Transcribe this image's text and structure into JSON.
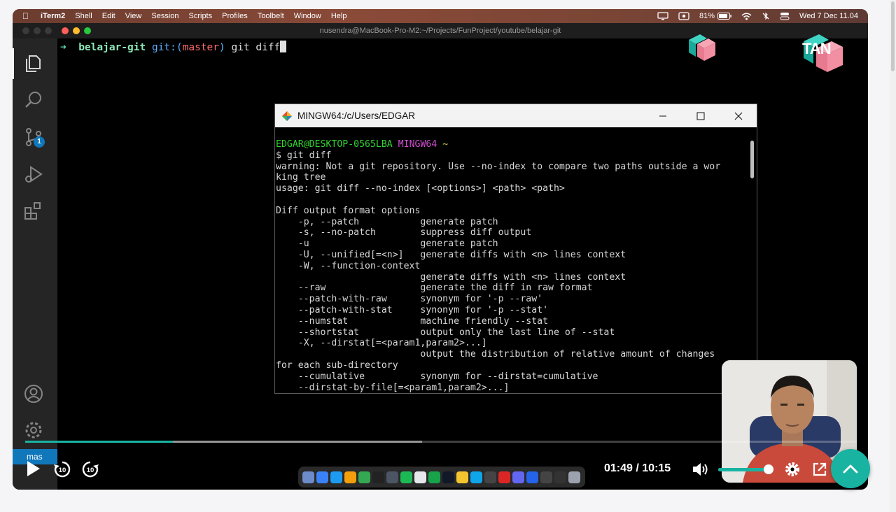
{
  "menubar": {
    "app": "iTerm2",
    "items": [
      "Shell",
      "Edit",
      "View",
      "Session",
      "Scripts",
      "Profiles",
      "Toolbelt",
      "Window",
      "Help"
    ],
    "battery": "81%",
    "clock": "Wed 7 Dec  11.04"
  },
  "iterm": {
    "title": "nusendra@MacBook-Pro-M2:~/Projects/FunProject/youtube/belajar-git",
    "prompt_dir": "belajar-git",
    "prompt_git": "git:(",
    "prompt_branch": "master",
    "prompt_git_close": ")",
    "command": " git diff"
  },
  "activity": {
    "scm_badge": "1",
    "branch": "mas"
  },
  "logo_text": "TAN",
  "mingw": {
    "title": "MINGW64:/c/Users/EDGAR",
    "prompt_user": "EDGAR@DESKTOP-0565LBA",
    "prompt_env": "MINGW64",
    "prompt_path": "~",
    "lines": [
      "$ git diff",
      "warning: Not a git repository. Use --no-index to compare two paths outside a wor",
      "king tree",
      "usage: git diff --no-index [<options>] <path> <path>",
      "",
      "Diff output format options",
      "    -p, --patch           generate patch",
      "    -s, --no-patch        suppress diff output",
      "    -u                    generate patch",
      "    -U, --unified[=<n>]   generate diffs with <n> lines context",
      "    -W, --function-context",
      "                          generate diffs with <n> lines context",
      "    --raw                 generate the diff in raw format",
      "    --patch-with-raw      synonym for '-p --raw'",
      "    --patch-with-stat     synonym for '-p --stat'",
      "    --numstat             machine friendly --stat",
      "    --shortstat           output only the last line of --stat",
      "    -X, --dirstat[=<param1,param2>...]",
      "                          output the distribution of relative amount of changes",
      "for each sub-directory",
      "    --cumulative          synonym for --dirstat=cumulative",
      "    --dirstat-by-file[=<param1,param2>...]"
    ]
  },
  "video": {
    "current_time": "01:49",
    "separator": "/",
    "duration": "10:15",
    "progress_fraction": 0.178,
    "buffered_fraction": 0.477,
    "volume_fraction": 1.0,
    "accent": "#19b3a2"
  }
}
